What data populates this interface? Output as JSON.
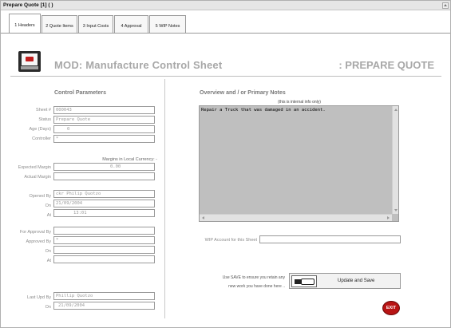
{
  "window": {
    "title": "Prepare Quote [1]  ( )"
  },
  "tabs": [
    {
      "label": "1 Headers",
      "active": true
    },
    {
      "label": "2 Quote Items",
      "active": false
    },
    {
      "label": "3 Input Costs",
      "active": false
    },
    {
      "label": "4 Approval",
      "active": false
    },
    {
      "label": "5 WIP Notes",
      "active": false
    }
  ],
  "header": {
    "title": "MOD: Manufacture Control Sheet",
    "status": ": PREPARE QUOTE"
  },
  "control": {
    "section_title": "Control Parameters",
    "sheet_label": "Sheet #",
    "sheet_value": "000043",
    "status_label": "Status",
    "status_value": "Prepare Quote",
    "age_label": "Age (Days)",
    "age_value": "0",
    "controller_label": "Controller",
    "controller_value": "*",
    "margins_note": "Margins in Local Currency: -",
    "expected_margin_label": "Expected Margin",
    "expected_margin_value": "0.00",
    "actual_margin_label": "Actual Margin",
    "actual_margin_value": "",
    "opened_by_label": "Opened By",
    "opened_by_value": "ckr Philip Quotzo",
    "opened_on_label": "On",
    "opened_on_value": "21/09/2004",
    "opened_at_label": "At",
    "opened_at_value": "13:01",
    "for_approval_by_label": "For Approval By",
    "for_approval_by_value": "",
    "approved_by_label": "Approved By",
    "approved_by_value": "*",
    "approved_on_label": "On",
    "approved_on_value": "",
    "approved_at_label": "At",
    "approved_at_value": "",
    "last_upd_by_label": "Last Upd By",
    "last_upd_by_value": "Phillip Quotzo",
    "last_upd_on_label": "On",
    "last_upd_on_value": "21/09/2004"
  },
  "notes": {
    "section_title": "Overview and / or Primary Notes",
    "subtitle": "(this is internal info only)",
    "text": "Repair a Truck that was damaged in an accident.",
    "wip_account_label": "WIP Account for this Sheet",
    "wip_account_value": ""
  },
  "save": {
    "hint_line1": "Use SAVE to ensure you retain any",
    "hint_line2": "new work you have done here ..",
    "button_label": "Update and Save"
  },
  "exit": {
    "label": "EXIT"
  },
  "icons": {
    "logo": "control-sheet-logo-icon",
    "save": "pointing-hand-icon",
    "exit": "exit-icon",
    "scroll_up": "scroll-up-arrow-icon"
  }
}
